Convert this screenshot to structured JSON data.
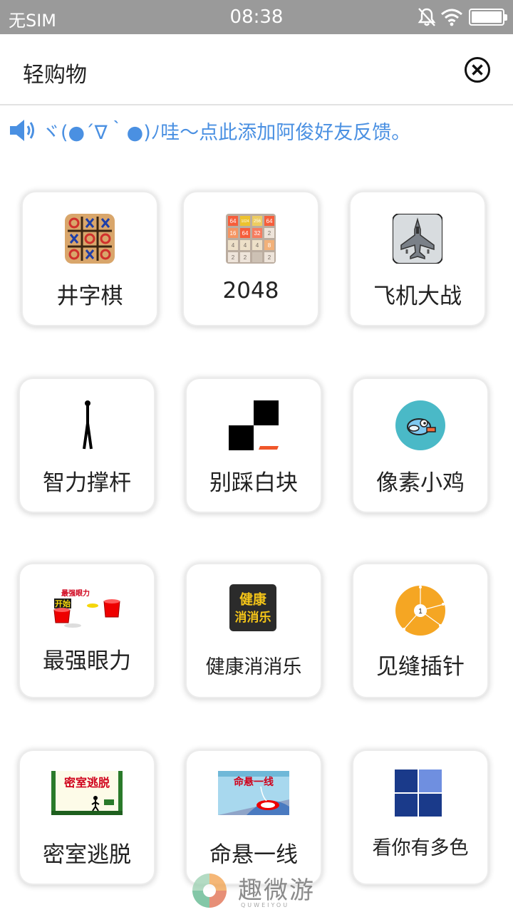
{
  "status_bar": {
    "carrier": "无SIM",
    "time": "08:38",
    "icons": [
      "bell-muted-icon",
      "wifi-icon",
      "battery-icon"
    ]
  },
  "header": {
    "title": "轻购物",
    "close_icon": "close-circle-icon"
  },
  "notice": {
    "icon": "speaker-icon",
    "text": "ヾ(●´∇｀●)ﾉ哇～点此添加阿俊好友反馈。"
  },
  "games": [
    {
      "label": "井字棋",
      "icon": "tic-tac-toe-icon"
    },
    {
      "label": "2048",
      "icon": "2048-icon"
    },
    {
      "label": "飞机大战",
      "icon": "fighter-jet-icon"
    },
    {
      "label": "智力撑杆",
      "icon": "stick-figure-icon"
    },
    {
      "label": "别踩白块",
      "icon": "piano-tiles-icon"
    },
    {
      "label": "像素小鸡",
      "icon": "flappy-bird-icon"
    },
    {
      "label": "最强眼力",
      "icon": "cups-icon"
    },
    {
      "label": "健康消消乐",
      "icon": "match-game-icon"
    },
    {
      "label": "见缝插针",
      "icon": "pin-circle-icon"
    },
    {
      "label": "密室逃脱",
      "icon": "escape-room-icon"
    },
    {
      "label": "命悬一线",
      "icon": "rope-game-icon"
    },
    {
      "label": "看你有多色",
      "icon": "color-squares-icon"
    }
  ],
  "tile_icon_text": {
    "t2048": [
      "64",
      "1024",
      "256",
      "64",
      "16",
      "64",
      "32",
      "2",
      "4",
      "4",
      "4",
      "8",
      "2",
      "2",
      "2"
    ],
    "cups": [
      "最强眼力",
      "开始"
    ],
    "match": [
      "健康",
      "消消乐"
    ],
    "pin_number": "1",
    "escape": "密室逃脱",
    "rope": "命悬一线"
  },
  "watermark": {
    "text": "趣微游",
    "sub": "QUWEIYOU"
  },
  "colors": {
    "status_bar": "#9a9a9a",
    "notice_text": "#4a90e2",
    "pin_orange": "#f5a623",
    "bird_bg": "#4ab9c7",
    "color_squares_dark": "#1a3a8a",
    "color_squares_light": "#6f8fe0"
  }
}
